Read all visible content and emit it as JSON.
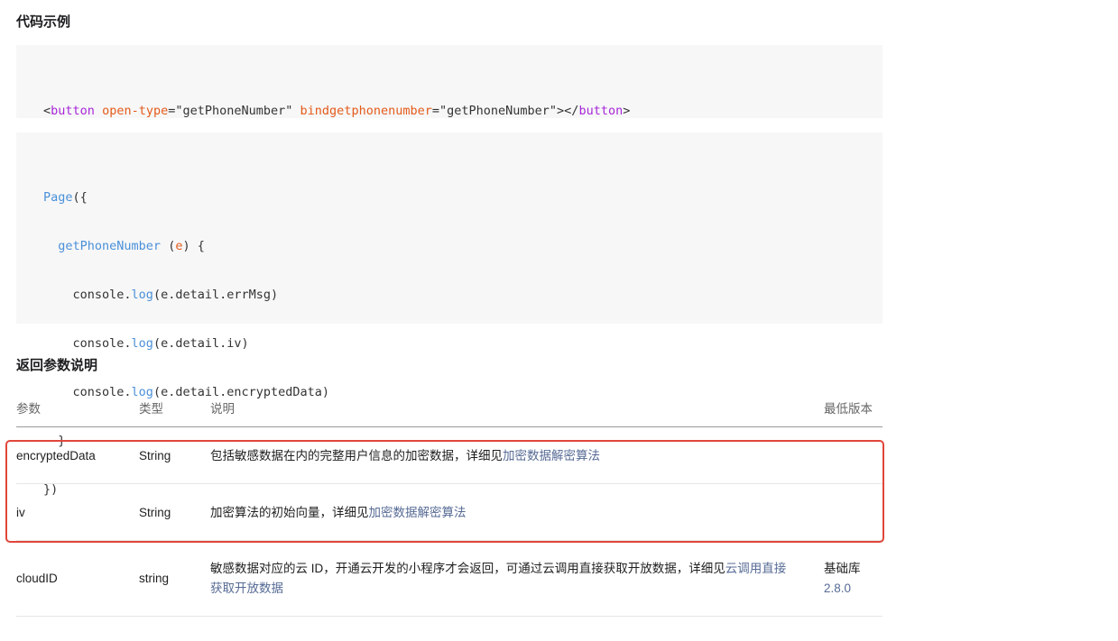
{
  "section1_title": "代码示例",
  "code1": {
    "open_lt": "<",
    "tag": "button",
    "attr1": "open-type",
    "eq1": "=",
    "val1": "\"getPhoneNumber\"",
    "attr2": "bindgetphonenumber",
    "eq2": "=",
    "val2": "\"getPhoneNumber\"",
    "close_mid": "></",
    "tag_close": "button",
    "close_gt": ">"
  },
  "code2": {
    "l1_fn": "Page",
    "l1_rest": "({",
    "l2_indent": "  ",
    "l2_fn": "getPhoneNumber",
    "l2_open": " (",
    "l2_param": "e",
    "l2_close": ") {",
    "l3_a": "    console.",
    "l3_fn": "log",
    "l3_b": "(e.detail.errMsg)",
    "l4_a": "    console.",
    "l4_fn": "log",
    "l4_b": "(e.detail.iv)",
    "l5_a": "    console.",
    "l5_fn": "log",
    "l5_b": "(e.detail.encryptedData)",
    "l6": "  }",
    "l7": "})"
  },
  "section2_title": "返回参数说明",
  "table": {
    "headers": {
      "name": "参数",
      "type": "类型",
      "desc": "说明",
      "version": "最低版本"
    },
    "rows": [
      {
        "name": "encryptedData",
        "type": "String",
        "desc": "包括敏感数据在内的完整用户信息的加密数据，详细见",
        "link": "加密数据解密算法",
        "version": ""
      },
      {
        "name": "iv",
        "type": "String",
        "desc": "加密算法的初始向量，详细见",
        "link": "加密数据解密算法",
        "version": ""
      },
      {
        "name": "cloudID",
        "type": "string",
        "desc": "敏感数据对应的云 ID，开通云开发的小程序才会返回，可通过云调用直接获取开放数据，详细见",
        "link": "云调用直接获取开放数据",
        "version_prefix": "基础库",
        "version_link": "2.8.0"
      }
    ]
  },
  "colors": {
    "highlight": "#e0463a",
    "link": "#576b95",
    "code_bg": "#f7f7f7"
  }
}
